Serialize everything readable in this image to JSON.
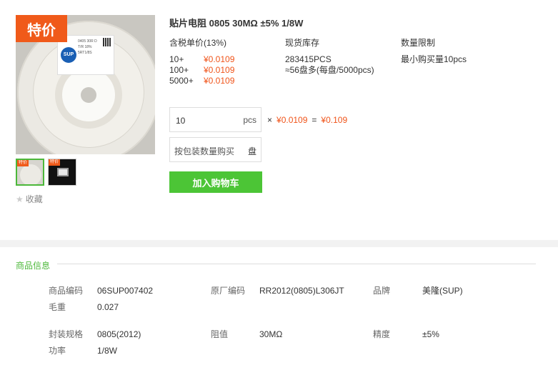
{
  "image": {
    "badge": "特价",
    "thumb_badge": "特价",
    "logo_text": "SUP",
    "label_lines": [
      "0405 30R D",
      "T/R 18%",
      "5RT1/8S"
    ]
  },
  "favorite": {
    "label": "收藏"
  },
  "product": {
    "title": "贴片电阻 0805 30MΩ ±5% 1/8W",
    "price_header": "含税单价(13%)",
    "stock_header": "现货库存",
    "limit_header": "数量限制",
    "tiers": [
      {
        "qty": "10+",
        "price": "¥0.0109"
      },
      {
        "qty": "100+",
        "price": "¥0.0109"
      },
      {
        "qty": "5000+",
        "price": "¥0.0109"
      }
    ],
    "stock_count": "283415PCS",
    "stock_reels": "≈56盘多(每盘/5000pcs)",
    "limit_text": "最小购买量10pcs"
  },
  "order": {
    "quantity": "10",
    "unit": "pcs",
    "times": "×",
    "unit_price": "¥0.0109",
    "equals": "=",
    "total": "¥0.109",
    "pack_placeholder": "按包装数量购买",
    "pack_unit": "盘",
    "cart_label": "加入购物车"
  },
  "info": {
    "title": "商品信息",
    "rows": [
      {
        "l1": "商品编码",
        "v1": "06SUP007402",
        "l2": "原厂编码",
        "v2": "RR2012(0805)L306JT",
        "l3": "品牌",
        "v3": "美隆(SUP)"
      },
      {
        "l1": "毛重",
        "v1": "0.027"
      },
      {
        "l1": "封装规格",
        "v1": "0805(2012)",
        "l2": "阻值",
        "v2": "30MΩ",
        "l3": "精度",
        "v3": "±5%"
      },
      {
        "l1": "功率",
        "v1": "1/8W"
      }
    ]
  },
  "colors": {
    "accent_green": "#4cc536",
    "price_red": "#f0541a",
    "badge_orange": "#f05a1a"
  }
}
